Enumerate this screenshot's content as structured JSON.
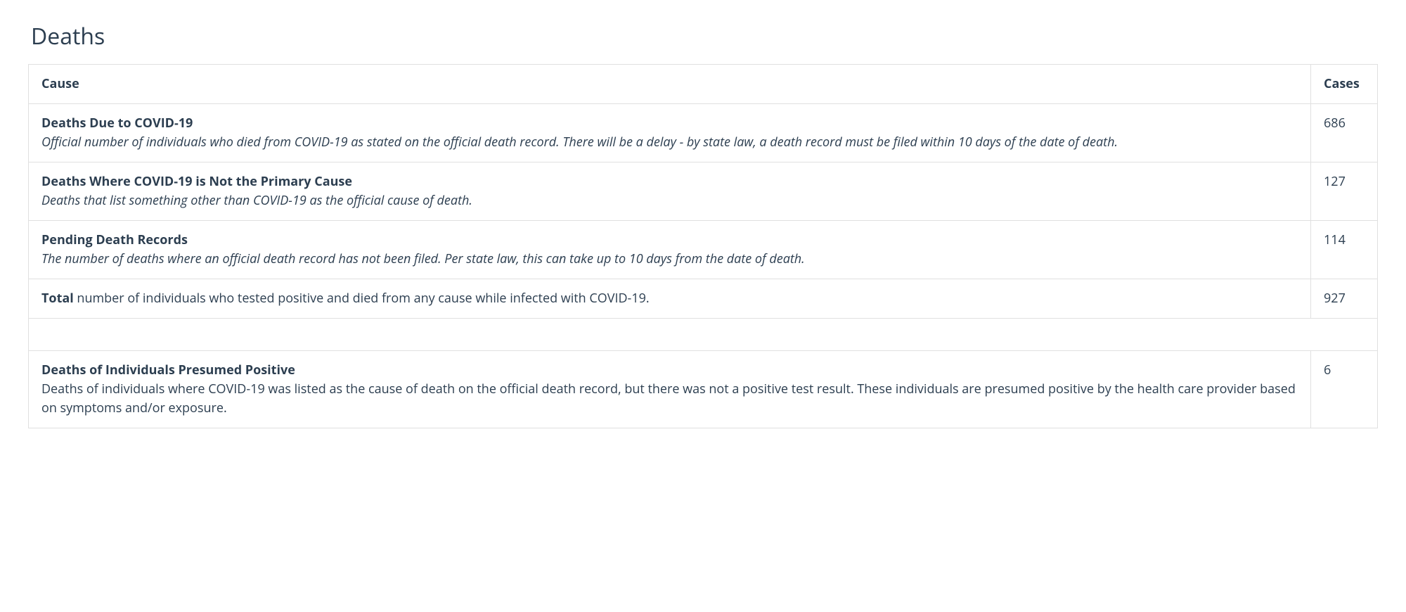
{
  "section_title": "Deaths",
  "headers": {
    "cause": "Cause",
    "cases": "Cases"
  },
  "rows": [
    {
      "title": "Deaths Due to COVID-19",
      "desc": "Official number of individuals who died from COVID-19 as stated on the official death record. There will be a delay - by state law, a death record must be filed within 10 days of the date of death.",
      "italic": true,
      "cases": "686"
    },
    {
      "title": "Deaths Where COVID-19 is Not the Primary Cause",
      "desc": "Deaths that list something other than COVID-19 as the official cause of death.",
      "italic": true,
      "cases": "127"
    },
    {
      "title": "Pending Death Records",
      "desc": "The number of deaths where an official death record has not been filed. Per state law, this can take up to 10 days from the date of death.",
      "italic": true,
      "cases": "114"
    }
  ],
  "total_row": {
    "label": "Total",
    "desc": " number of individuals who tested positive and died from any cause while infected with COVID-19.",
    "cases": "927"
  },
  "presumed_row": {
    "title": "Deaths of Individuals Presumed Positive",
    "desc": "Deaths of individuals where COVID-19 was listed as the cause of death on the official death record, but there was not a positive test result. These individuals are presumed positive by the health care provider based on symptoms and/or exposure.",
    "cases": "6"
  },
  "chart_data": {
    "type": "table",
    "title": "Deaths",
    "columns": [
      "Cause",
      "Cases"
    ],
    "rows": [
      [
        "Deaths Due to COVID-19",
        686
      ],
      [
        "Deaths Where COVID-19 is Not the Primary Cause",
        127
      ],
      [
        "Pending Death Records",
        114
      ],
      [
        "Total",
        927
      ],
      [
        "Deaths of Individuals Presumed Positive",
        6
      ]
    ]
  }
}
